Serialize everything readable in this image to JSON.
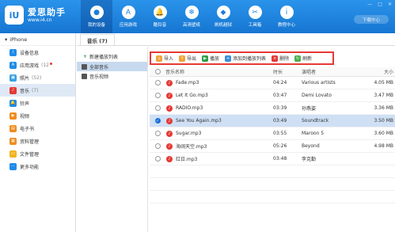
{
  "brand": {
    "name": "爱思助手",
    "url": "www.i4.cn",
    "logo_text": "iU"
  },
  "nav": [
    {
      "label": "我的设备",
      "icon": "apple-icon",
      "glyph": ""
    },
    {
      "label": "应用游戏",
      "icon": "app-store-icon",
      "glyph": "A"
    },
    {
      "label": "酷铃音",
      "icon": "bell-icon",
      "glyph": "🔔"
    },
    {
      "label": "高清壁纸",
      "icon": "snowflake-icon",
      "glyph": "❄"
    },
    {
      "label": "刷机越狱",
      "icon": "dropbox-icon",
      "glyph": "◆"
    },
    {
      "label": "工具箱",
      "icon": "tools-icon",
      "glyph": "✂"
    },
    {
      "label": "教程中心",
      "icon": "info-icon",
      "glyph": "i"
    }
  ],
  "window": {
    "download_label": "下载中心",
    "minimize": "—",
    "maximize": "□",
    "close": "✕"
  },
  "sidebar": {
    "device": "iPhone",
    "items": [
      {
        "label": "设备信息",
        "count": "",
        "color": "#1e8ce8",
        "glyph": "i"
      },
      {
        "label": "应用游戏",
        "count": "(12",
        "color": "#1e8ce8",
        "glyph": "A",
        "dot": true
      },
      {
        "label": "照片",
        "count": "(52)",
        "color": "#3aa0e0",
        "glyph": "▣"
      },
      {
        "label": "音乐",
        "count": "(7)",
        "color": "#e53935",
        "glyph": "♪",
        "active": true
      },
      {
        "label": "铃声",
        "count": "",
        "color": "#1e8ce8",
        "glyph": "🔔"
      },
      {
        "label": "视频",
        "count": "",
        "color": "#f08c1e",
        "glyph": "▶"
      },
      {
        "label": "电子书",
        "count": "",
        "color": "#f08c1e",
        "glyph": "▤"
      },
      {
        "label": "资料管理",
        "count": "",
        "color": "#f08c1e",
        "glyph": "▦"
      },
      {
        "label": "文件管理",
        "count": "",
        "color": "#f0b41e",
        "glyph": "▭"
      },
      {
        "label": "更多功能",
        "count": "",
        "color": "#1e8ce8",
        "glyph": "⋯"
      }
    ]
  },
  "tab": {
    "label": "音乐 (7)"
  },
  "subnav": {
    "new_playlist": "新建播放列表",
    "items": [
      {
        "label": "全部音乐",
        "active": true
      },
      {
        "label": "音乐视频",
        "active": false
      }
    ]
  },
  "toolbar": [
    {
      "label": "导入",
      "icon": "import-icon",
      "color": "#f2a33a",
      "glyph": "↓"
    },
    {
      "label": "导出",
      "icon": "export-icon",
      "color": "#f2a33a",
      "glyph": "↑"
    },
    {
      "label": "播放",
      "icon": "play-icon",
      "color": "#2e9d46",
      "glyph": "▶"
    },
    {
      "label": "添加到播放列表",
      "icon": "add-playlist-icon",
      "color": "#3a8fd8",
      "glyph": "+"
    },
    {
      "label": "删除",
      "icon": "delete-icon",
      "color": "#e53935",
      "glyph": "×"
    },
    {
      "label": "刷新",
      "icon": "refresh-icon",
      "color": "#4caf50",
      "glyph": "↻"
    }
  ],
  "table": {
    "headers": {
      "name": "音乐名称",
      "duration": "时长",
      "artist": "演唱者",
      "size": "大小"
    },
    "rows": [
      {
        "name": "Fade.mp3",
        "duration": "04:24",
        "artist": "Various artists",
        "size": "4.05 MB",
        "selected": false
      },
      {
        "name": "Let It Go.mp3",
        "duration": "03:47",
        "artist": "Demi Lovato",
        "size": "3.47 MB",
        "selected": false
      },
      {
        "name": "RADIO.mp3",
        "duration": "03:39",
        "artist": "孙燕姿",
        "size": "3.36 MB",
        "selected": false
      },
      {
        "name": "See You Again.mp3",
        "duration": "03:49",
        "artist": "Soundtrack",
        "size": "3.50 MB",
        "selected": true
      },
      {
        "name": "Sugar.mp3",
        "duration": "03:55",
        "artist": "Maroon 5",
        "size": "3.60 MB",
        "selected": false
      },
      {
        "name": "海阔天空.mp3",
        "duration": "05:26",
        "artist": "Beyond",
        "size": "4.98 MB",
        "selected": false
      },
      {
        "name": "红日.mp3",
        "duration": "03:48",
        "artist": "李克勤",
        "size": "",
        "selected": false
      }
    ]
  },
  "colors": {
    "primary": "#1f88e5",
    "highlight": "#e53935",
    "selection": "#cfe0f5"
  }
}
